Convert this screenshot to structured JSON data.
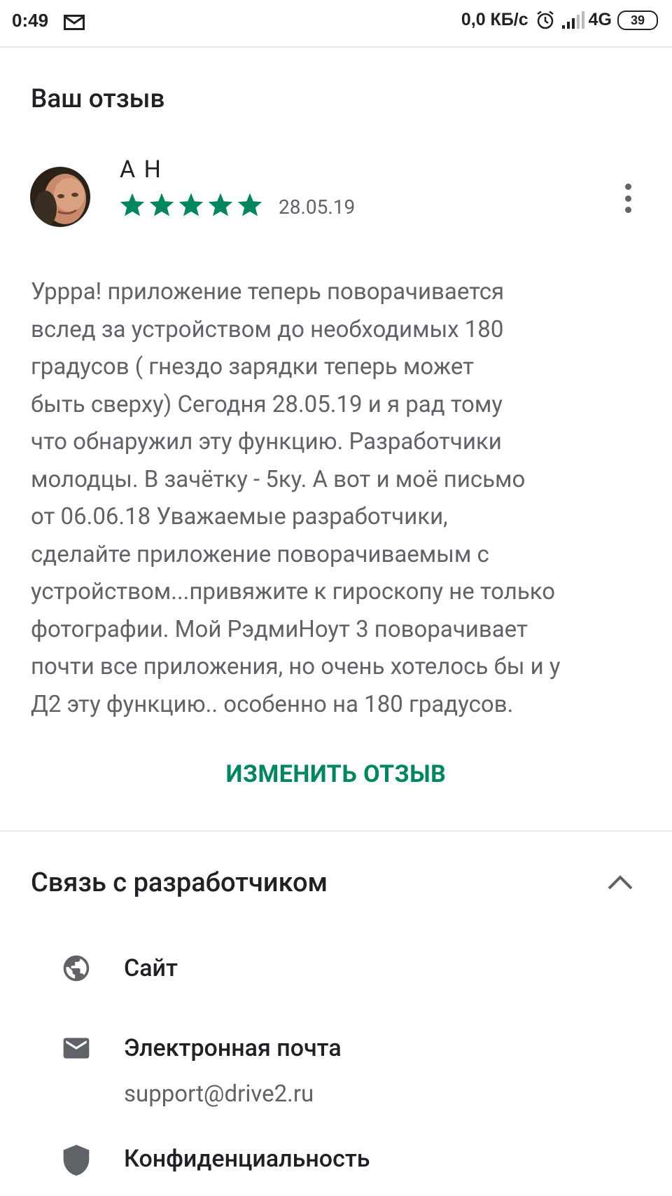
{
  "status_bar": {
    "time": "0:49",
    "net_speed": "0,0 КБ/с",
    "network": "4G",
    "battery": "39"
  },
  "review_section": {
    "title": "Ваш отзыв",
    "author": "А Н",
    "rating": 5,
    "rating_max": 5,
    "date": "28.05.19",
    "text": "Урррa! приложение теперь поворачивается\nвслед за устройством до необходимых 180\nградусов ( гнездо зарядки теперь может\nбыть сверху) Сегодня 28.05.19 и я рад тому\nчто обнаружил эту функцию. Разработчики\nмолодцы. В зачётку - 5ку. А вот и моё письмо\nот 06.06.18 Уважаемые разработчики,\nсделайте приложение поворачиваемым с\nустройством...привяжите к гироскопу не только\nфотографии. Мой РэдмиНоут 3 поворачивает\nпочти все приложения, но очень хотелось бы и у\nД2 эту функцию.. особенно на 180 градусов.",
    "edit_label": "ИЗМЕНИТЬ ОТЗЫВ"
  },
  "developer_section": {
    "title": "Связь с разработчиком",
    "items": [
      {
        "icon": "globe-icon",
        "label": "Сайт"
      },
      {
        "icon": "mail-icon",
        "label": "Электронная почта",
        "sub": "support@drive2.ru"
      },
      {
        "icon": "shield-icon",
        "label": "Конфиденциальность"
      }
    ]
  },
  "colors": {
    "accent": "#01875f",
    "star": "#01875f",
    "secondary_text": "#5f6368",
    "primary_text": "#202124"
  }
}
